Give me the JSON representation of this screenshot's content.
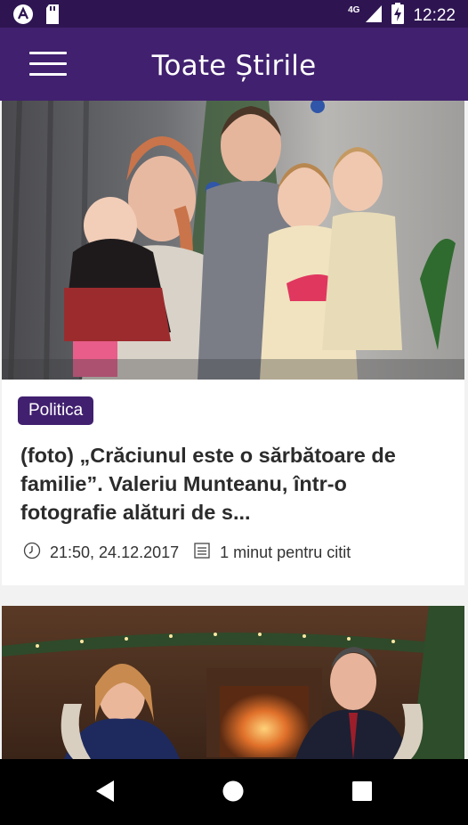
{
  "status_bar": {
    "time": "12:22",
    "network": "4G",
    "icons": [
      "app-notification-icon",
      "sd-card-icon",
      "signal-icon",
      "battery-charging-icon"
    ]
  },
  "app_bar": {
    "title": "Toate Știrile",
    "menu_icon": "hamburger-menu-icon"
  },
  "articles": [
    {
      "category": "Politica",
      "title": "(foto) „Crăciunul este o sărbătoare de familie”. Valeriu Munteanu, într-o fotografie alături de s...",
      "datetime": "21:50, 24.12.2017",
      "read_time": "1 minut pentru citit",
      "image": "family-photo"
    },
    {
      "image": "holiday-fireplace-photo"
    }
  ],
  "nav_bar": {
    "buttons": [
      "back-icon",
      "home-icon",
      "recents-icon"
    ]
  },
  "colors": {
    "status_bar": "#2e1552",
    "app_bar": "#41206f",
    "badge": "#41206f",
    "background": "#f2f2f2"
  }
}
